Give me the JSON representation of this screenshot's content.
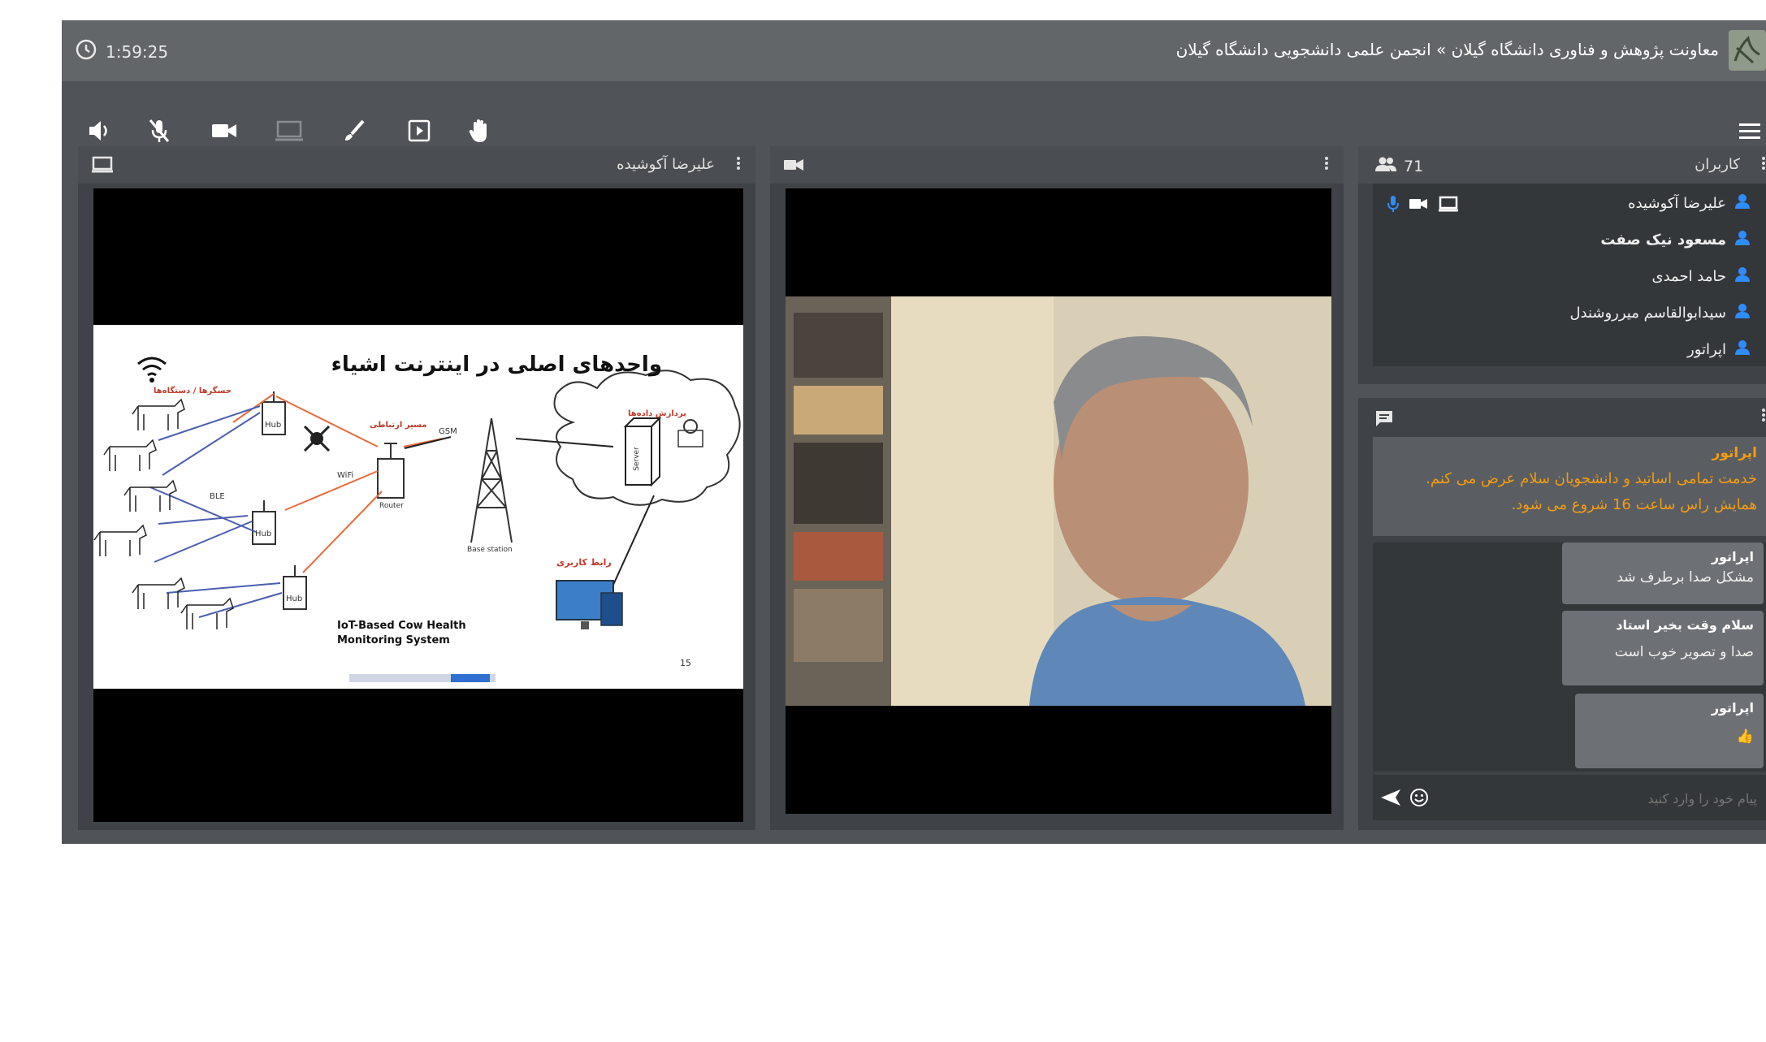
{
  "header": {
    "timer": "1:59:25",
    "title": "معاونت پژوهش و فناوری دانشگاه گیلان » انجمن علمی دانشجویی دانشگاه گیلان"
  },
  "toolbar": {
    "icons": [
      "speaker-icon",
      "mic-off-icon",
      "camera-icon",
      "screen-share-icon",
      "brush-icon",
      "present-icon",
      "raise-hand-icon",
      "menu-icon"
    ]
  },
  "screen_share_panel": {
    "presenter": "علیرضا آکوشیده"
  },
  "slide": {
    "title": "واحدهای اصلی در اینترنت اشیاء",
    "sensors_label": "حسگرها / دستگاه‌ها",
    "gateway_label": "مسیر ارتباطی",
    "processing_label": "پردازش داده‌ها",
    "user_interface_label": "رابط کاربری",
    "hub": "Hub",
    "ble": "BLE",
    "wifi": "WiFi",
    "gsm": "GSM",
    "router": "Router",
    "base_station": "Base station",
    "server": "Server",
    "system_title": "IoT-Based Cow Health Monitoring System",
    "page_number": "15"
  },
  "users_panel": {
    "title": "کاربران",
    "count": "71",
    "users": [
      {
        "name": "علیرضا آکوشیده",
        "bold": false
      },
      {
        "name": "مسعود نیک صفت",
        "bold": true
      },
      {
        "name": "حامد احمدی",
        "bold": false
      },
      {
        "name": "سیدابوالقاسم میرروشندل",
        "bold": false
      },
      {
        "name": "اپراتور",
        "bold": false
      }
    ]
  },
  "chat": {
    "pinned": {
      "author": "اپراتور",
      "text": "خدمت تمامی اساتید و دانشجویان سلام عرض می کنم. همایش راس ساعت 16 شروع می شود."
    },
    "messages": [
      {
        "author": "اپراتور",
        "text": "مشکل صدا برطرف شد"
      },
      {
        "author": "سلام وقت بخیر استاد",
        "text": "صدا و تصویر خوب است"
      },
      {
        "author": "اپراتور",
        "text": "👍"
      }
    ],
    "input_placeholder": "پیام خود را وارد کنید"
  },
  "colors": {
    "accent": "#2f8cff",
    "pinned_text": "#f39c12",
    "pinned_bg": "#5a5e62"
  }
}
